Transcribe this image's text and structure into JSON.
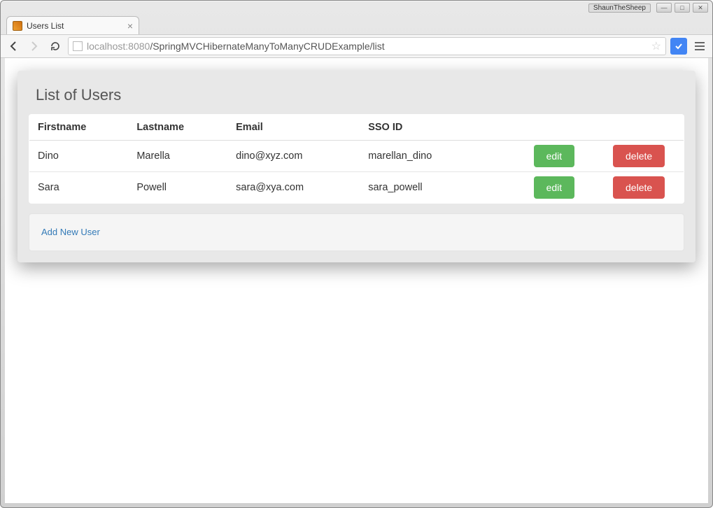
{
  "window": {
    "user": "ShaunTheSheep"
  },
  "browser": {
    "tab_title": "Users List",
    "url_host": "localhost",
    "url_port": ":8080",
    "url_path": "/SpringMVCHibernateManyToManyCRUDExample/list"
  },
  "page": {
    "title": "List of Users",
    "headers": {
      "firstname": "Firstname",
      "lastname": "Lastname",
      "email": "Email",
      "sso": "SSO ID"
    },
    "buttons": {
      "edit": "edit",
      "delete": "delete"
    },
    "users": [
      {
        "firstname": "Dino",
        "lastname": "Marella",
        "email": "dino@xyz.com",
        "sso": "marellan_dino"
      },
      {
        "firstname": "Sara",
        "lastname": "Powell",
        "email": "sara@xya.com",
        "sso": "sara_powell"
      }
    ],
    "add_link": "Add New User"
  }
}
